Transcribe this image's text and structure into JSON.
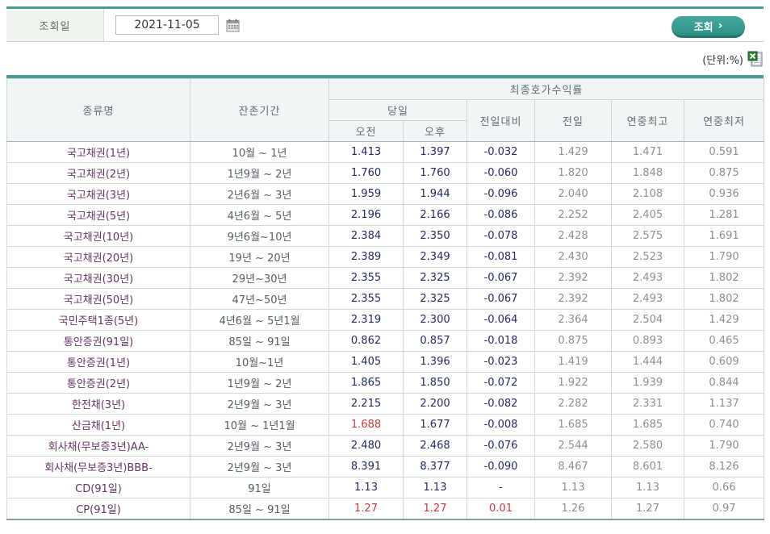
{
  "search": {
    "label": "조회일",
    "date_value": "2021-11-05",
    "button_label": "조회",
    "button_arrow": "›"
  },
  "unit_note": "(단위:%)",
  "colors": {
    "accent_teal": "#4a9c92",
    "value_navy": "#222a66",
    "value_red": "#cc3838",
    "value_gray": "#8a8f94",
    "type_purple": "#663366"
  },
  "table": {
    "headers": {
      "col_type": "종류명",
      "col_maturity": "잔존기간",
      "group_yield": "최종호가수익률",
      "group_today": "당일",
      "col_am": "오전",
      "col_pm": "오후",
      "col_change": "전일대비",
      "col_prev": "전일",
      "col_year_high": "연중최고",
      "col_year_low": "연중최저"
    },
    "rows": [
      {
        "type": "국고채권(1년)",
        "maturity": "10월 ~ 1년",
        "am": "1.413",
        "pm": "1.397",
        "change": "-0.032",
        "prev": "1.429",
        "high": "1.471",
        "low": "0.591"
      },
      {
        "type": "국고채권(2년)",
        "maturity": "1년9월 ~ 2년",
        "am": "1.760",
        "pm": "1.760",
        "change": "-0.060",
        "prev": "1.820",
        "high": "1.848",
        "low": "0.875"
      },
      {
        "type": "국고채권(3년)",
        "maturity": "2년6월 ~ 3년",
        "am": "1.959",
        "pm": "1.944",
        "change": "-0.096",
        "prev": "2.040",
        "high": "2.108",
        "low": "0.936"
      },
      {
        "type": "국고채권(5년)",
        "maturity": "4년6월 ~ 5년",
        "am": "2.196",
        "pm": "2.166",
        "change": "-0.086",
        "prev": "2.252",
        "high": "2.405",
        "low": "1.281"
      },
      {
        "type": "국고채권(10년)",
        "maturity": "9년6월~10년",
        "am": "2.384",
        "pm": "2.350",
        "change": "-0.078",
        "prev": "2.428",
        "high": "2.575",
        "low": "1.691"
      },
      {
        "type": "국고채권(20년)",
        "maturity": "19년 ~ 20년",
        "am": "2.389",
        "pm": "2.349",
        "change": "-0.081",
        "prev": "2.430",
        "high": "2.523",
        "low": "1.790"
      },
      {
        "type": "국고채권(30년)",
        "maturity": "29년~30년",
        "am": "2.355",
        "pm": "2.325",
        "change": "-0.067",
        "prev": "2.392",
        "high": "2.493",
        "low": "1.802"
      },
      {
        "type": "국고채권(50년)",
        "maturity": "47년~50년",
        "am": "2.355",
        "pm": "2.325",
        "change": "-0.067",
        "prev": "2.392",
        "high": "2.493",
        "low": "1.802"
      },
      {
        "type": "국민주택1종(5년)",
        "maturity": "4년6월 ~ 5년1월",
        "am": "2.319",
        "pm": "2.300",
        "change": "-0.064",
        "prev": "2.364",
        "high": "2.504",
        "low": "1.429"
      },
      {
        "type": "통안증권(91일)",
        "maturity": "85일 ~ 91일",
        "am": "0.862",
        "pm": "0.857",
        "change": "-0.018",
        "prev": "0.875",
        "high": "0.893",
        "low": "0.465"
      },
      {
        "type": "통안증권(1년)",
        "maturity": "10월~1년",
        "am": "1.405",
        "pm": "1.396",
        "change": "-0.023",
        "prev": "1.419",
        "high": "1.444",
        "low": "0.609"
      },
      {
        "type": "통안증권(2년)",
        "maturity": "1년9월 ~ 2년",
        "am": "1.865",
        "pm": "1.850",
        "change": "-0.072",
        "prev": "1.922",
        "high": "1.939",
        "low": "0.844"
      },
      {
        "type": "한전채(3년)",
        "maturity": "2년9월 ~ 3년",
        "am": "2.215",
        "pm": "2.200",
        "change": "-0.082",
        "prev": "2.282",
        "high": "2.331",
        "low": "1.137"
      },
      {
        "type": "산금채(1년)",
        "maturity": "10월 ~ 1년1월",
        "am": "1.688",
        "pm": "1.677",
        "change": "-0.008",
        "prev": "1.685",
        "high": "1.685",
        "low": "0.740",
        "red": [
          "am"
        ]
      },
      {
        "type": "회사채(무보증3년)AA-",
        "maturity": "2년9월 ~ 3년",
        "am": "2.480",
        "pm": "2.468",
        "change": "-0.076",
        "prev": "2.544",
        "high": "2.580",
        "low": "1.790"
      },
      {
        "type": "회사채(무보증3년)BBB-",
        "maturity": "2년9월 ~ 3년",
        "am": "8.391",
        "pm": "8.377",
        "change": "-0.090",
        "prev": "8.467",
        "high": "8.601",
        "low": "8.126"
      },
      {
        "type": "CD(91일)",
        "maturity": "91일",
        "am": "1.13",
        "pm": "1.13",
        "change": "-",
        "prev": "1.13",
        "high": "1.13",
        "low": "0.66"
      },
      {
        "type": "CP(91일)",
        "maturity": "85일 ~ 91일",
        "am": "1.27",
        "pm": "1.27",
        "change": "0.01",
        "prev": "1.26",
        "high": "1.27",
        "low": "0.97",
        "red": [
          "am",
          "pm",
          "change"
        ]
      }
    ]
  }
}
